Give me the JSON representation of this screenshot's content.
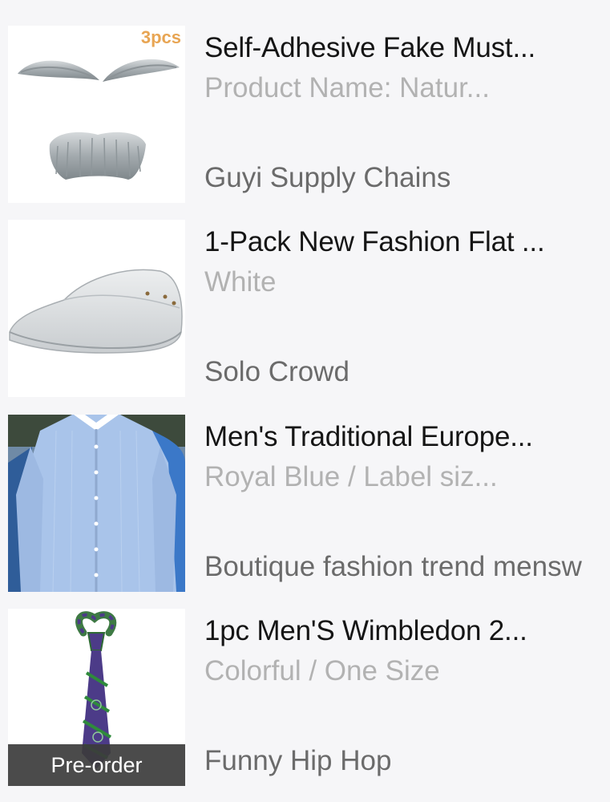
{
  "cart_items": [
    {
      "title": "Self-Adhesive Fake Must...",
      "variant": "Product Name: Natur...",
      "shop": "Guyi Supply Chains",
      "image_badge": "3pcs",
      "image_icon": "fake-mustache-eyebrows-product-image"
    },
    {
      "title": "1-Pack New Fashion Flat ...",
      "variant": "White",
      "shop": "Solo Crowd",
      "image_icon": "white-flat-cap-product-image"
    },
    {
      "title": "Men's Traditional Europe...",
      "variant": "Royal Blue / Label siz...",
      "shop": "Boutique fashion trend mensw",
      "image_icon": "blue-dress-shirt-product-image"
    },
    {
      "title": "1pc Men'S Wimbledon 2...",
      "variant": "Colorful / One Size",
      "shop": "Funny Hip Hop",
      "image_overlay": "Pre-order",
      "image_icon": "wimbledon-necktie-product-image"
    }
  ],
  "colors": {
    "background": "#f6f6f8",
    "title": "#151515",
    "variant": "#b2b2b2",
    "shop": "#6b6b6b",
    "badge": "#e8a553",
    "preorder_bg": "#3c3c3c"
  }
}
